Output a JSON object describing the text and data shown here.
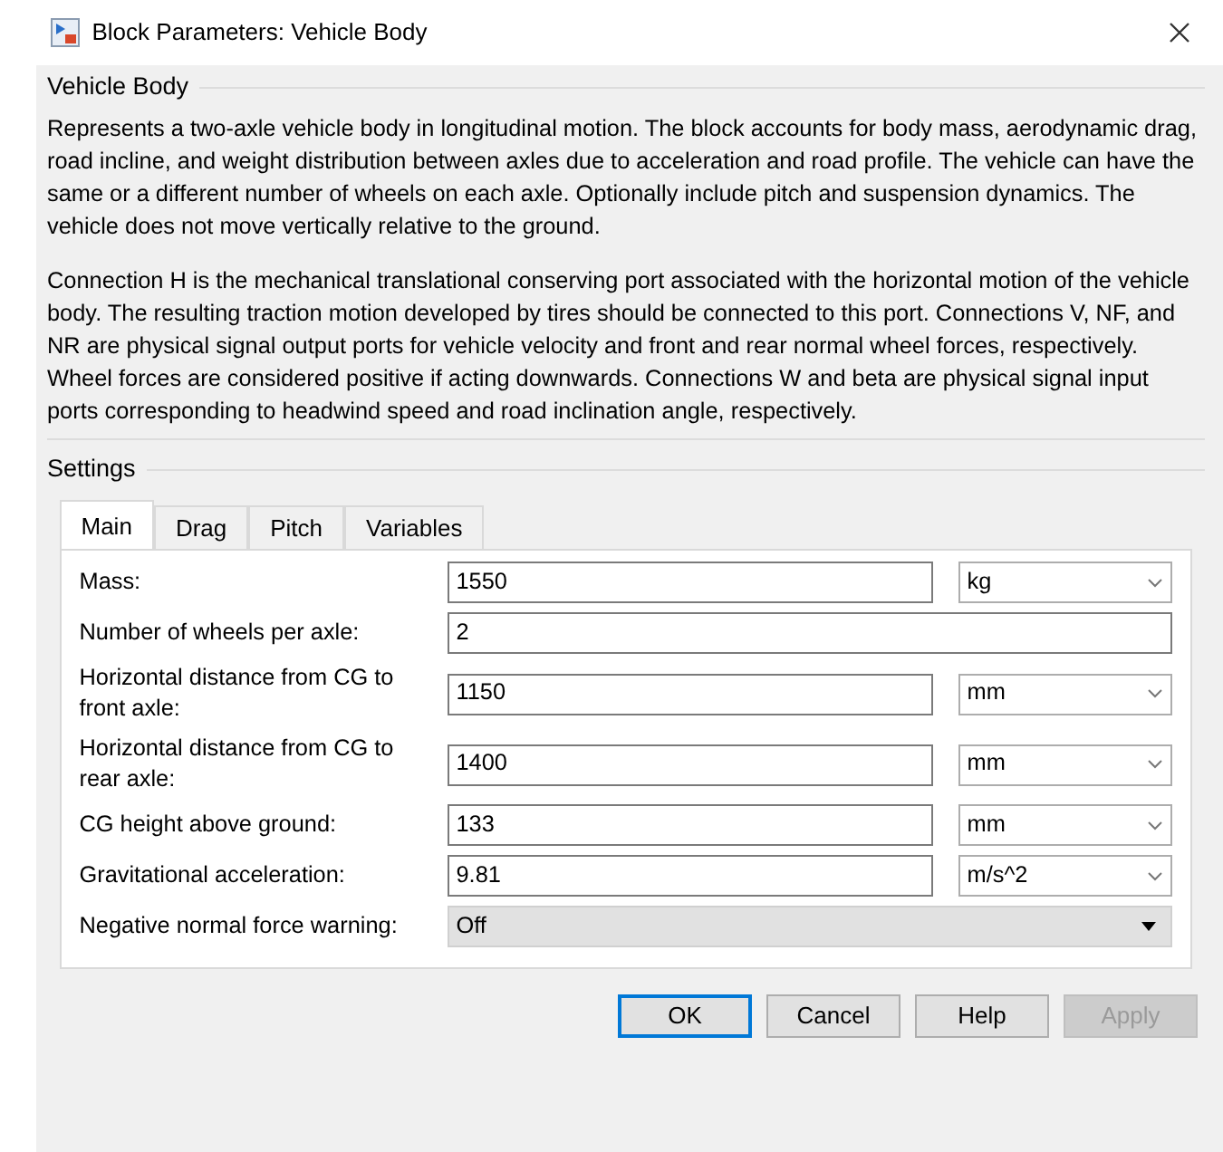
{
  "window": {
    "title": "Block Parameters: Vehicle Body"
  },
  "description": {
    "title": "Vehicle Body",
    "paragraphs": [
      "Represents a two-axle vehicle body in longitudinal motion. The block accounts for body mass, aerodynamic drag, road incline, and weight distribution between axles due to acceleration and road profile. The vehicle can have the same or a different number of wheels on each axle. Optionally include pitch and suspension dynamics. The vehicle does not move vertically relative to the ground.",
      "Connection H is the mechanical translational conserving port associated with the horizontal motion of the vehicle body. The resulting traction motion developed by tires should be connected to this port. Connections V, NF, and NR are physical signal output ports for vehicle velocity and front and rear normal wheel forces, respectively. Wheel forces are considered positive if acting downwards. Connections W and beta are physical signal input ports corresponding to headwind speed and road inclination angle, respectively."
    ]
  },
  "settings": {
    "title": "Settings",
    "tabs": [
      {
        "label": "Main",
        "selected": true
      },
      {
        "label": "Drag",
        "selected": false
      },
      {
        "label": "Pitch",
        "selected": false
      },
      {
        "label": "Variables",
        "selected": false
      }
    ],
    "parameters": [
      {
        "kind": "unit",
        "label": "Mass:",
        "value": "1550",
        "unit": "kg"
      },
      {
        "kind": "plain",
        "label": "Number of wheels per axle:",
        "value": "2"
      },
      {
        "kind": "unit",
        "label": "Horizontal distance from CG to front axle:",
        "value": "1150",
        "unit": "mm"
      },
      {
        "kind": "unit",
        "label": "Horizontal distance from CG to rear axle:",
        "value": "1400",
        "unit": "mm"
      },
      {
        "kind": "unit",
        "label": "CG height above ground:",
        "value": "133",
        "unit": "mm"
      },
      {
        "kind": "unit",
        "label": "Gravitational acceleration:",
        "value": "9.81",
        "unit": "m/s^2"
      },
      {
        "kind": "popup",
        "label": "Negative normal force warning:",
        "value": "Off"
      }
    ]
  },
  "buttons": [
    {
      "label": "OK",
      "default": true,
      "disabled": false
    },
    {
      "label": "Cancel",
      "default": false,
      "disabled": false
    },
    {
      "label": "Help",
      "default": false,
      "disabled": false
    },
    {
      "label": "Apply",
      "default": false,
      "disabled": true
    }
  ]
}
